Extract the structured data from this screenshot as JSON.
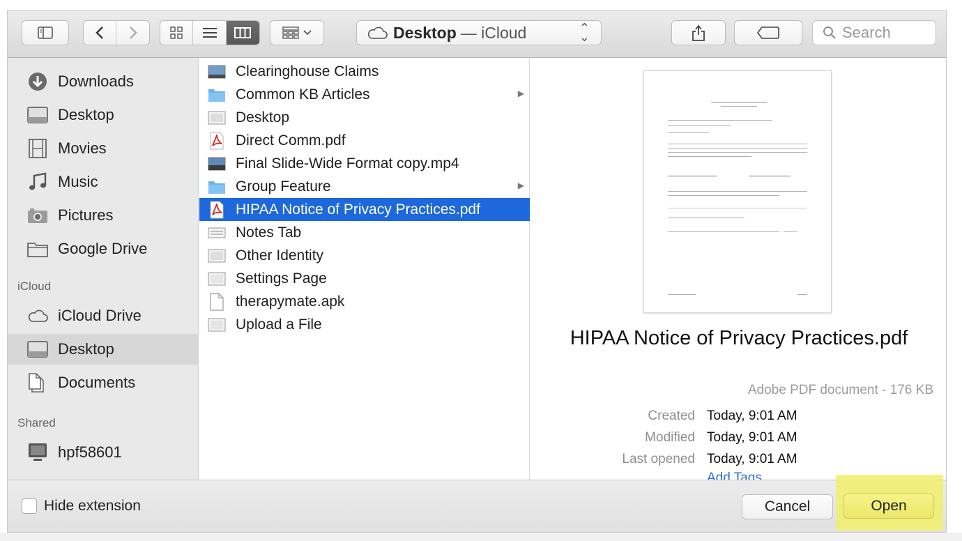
{
  "toolbar": {
    "path_location": "Desktop",
    "path_separator": "— iCloud",
    "search_placeholder": "Search"
  },
  "sidebar": {
    "favorites": [
      {
        "label": "Downloads",
        "icon": "downloads-icon"
      },
      {
        "label": "Desktop",
        "icon": "desktop-folder-icon"
      },
      {
        "label": "Movies",
        "icon": "film-icon"
      },
      {
        "label": "Music",
        "icon": "music-note-icon"
      },
      {
        "label": "Pictures",
        "icon": "camera-icon"
      },
      {
        "label": "Google Drive",
        "icon": "folder-icon"
      }
    ],
    "icloud_header": "iCloud",
    "icloud": [
      {
        "label": "iCloud Drive",
        "icon": "cloud-icon"
      },
      {
        "label": "Desktop",
        "icon": "desktop-folder-icon",
        "selected": true
      },
      {
        "label": "Documents",
        "icon": "documents-icon"
      }
    ],
    "shared_header": "Shared",
    "shared": [
      {
        "label": "hpf58601",
        "icon": "monitor-icon"
      }
    ]
  },
  "files": [
    {
      "name": "Clearinghouse Claims",
      "icon": "screenshot-icon"
    },
    {
      "name": "Common KB Articles",
      "icon": "folder-icon",
      "has_children": true
    },
    {
      "name": "Desktop",
      "icon": "screenshot-icon"
    },
    {
      "name": "Direct Comm.pdf",
      "icon": "pdf-icon"
    },
    {
      "name": "Final Slide-Wide Format copy.mp4",
      "icon": "video-icon"
    },
    {
      "name": "Group Feature",
      "icon": "folder-icon",
      "has_children": true
    },
    {
      "name": "HIPAA Notice of Privacy Practices.pdf",
      "icon": "pdf-icon",
      "selected": true
    },
    {
      "name": "Notes Tab",
      "icon": "screenshot-icon"
    },
    {
      "name": "Other Identity",
      "icon": "screenshot-icon"
    },
    {
      "name": "Settings Page",
      "icon": "screenshot-icon"
    },
    {
      "name": "therapymate.apk",
      "icon": "document-icon"
    },
    {
      "name": "Upload a File",
      "icon": "screenshot-icon"
    }
  ],
  "preview": {
    "title": "HIPAA Notice of Privacy Practices.pdf",
    "kind": "Adobe PDF document - 176 KB",
    "created_label": "Created",
    "created_value": "Today, 9:01 AM",
    "modified_label": "Modified",
    "modified_value": "Today, 9:01 AM",
    "opened_label": "Last opened",
    "opened_value": "Today, 9:01 AM",
    "add_tags": "Add Tags..."
  },
  "footer": {
    "hide_extension": "Hide extension",
    "cancel": "Cancel",
    "open": "Open",
    "highlight_color": "#f1f06a"
  }
}
